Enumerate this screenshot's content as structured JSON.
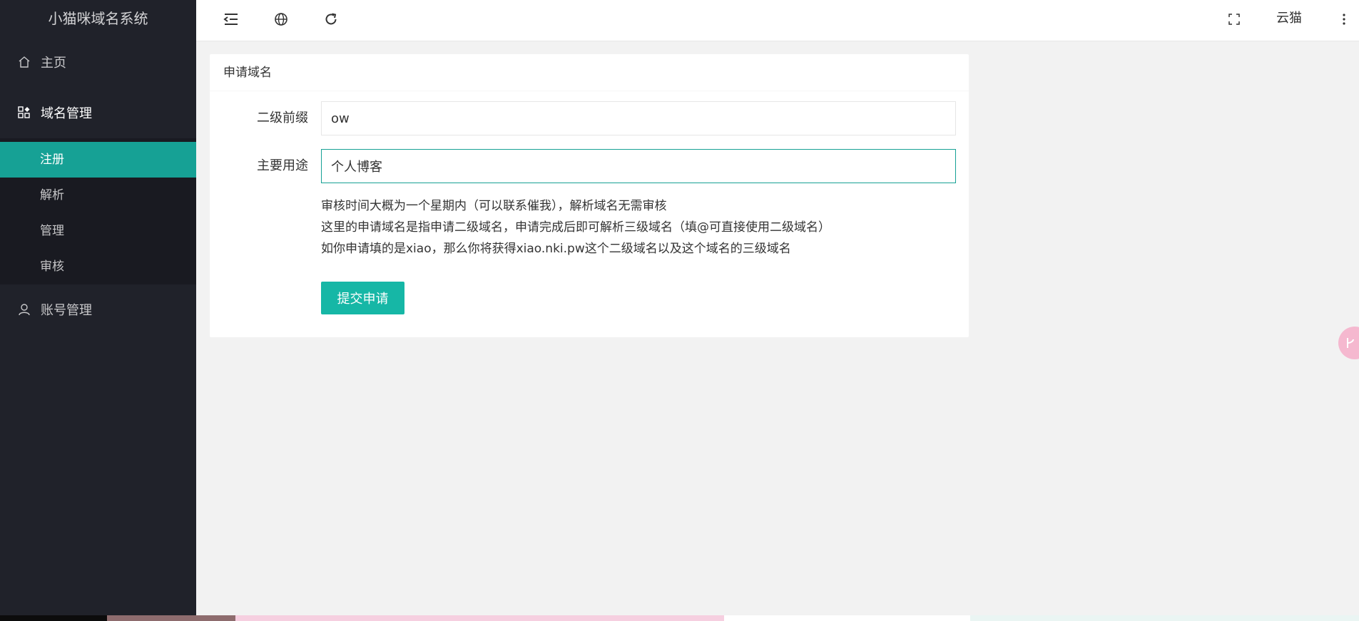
{
  "app": {
    "logo_text": "小猫咪域名系统"
  },
  "sidebar": {
    "items": [
      {
        "label": "主页",
        "icon": "home-icon"
      },
      {
        "label": "域名管理",
        "icon": "apps-icon",
        "expanded": true,
        "children": [
          {
            "label": "注册",
            "active": true
          },
          {
            "label": "解析"
          },
          {
            "label": "管理"
          },
          {
            "label": "审核"
          }
        ]
      },
      {
        "label": "账号管理",
        "icon": "user-icon"
      }
    ]
  },
  "header": {
    "icons": [
      "collapse-menu-icon",
      "globe-icon",
      "refresh-icon",
      "fullscreen-icon",
      "more-vertical-icon"
    ],
    "username": "云猫"
  },
  "card": {
    "title": "申请域名",
    "fields": [
      {
        "label": "二级前缀",
        "value": "ow"
      },
      {
        "label": "主要用途",
        "value": "个人博客"
      }
    ],
    "tips": [
      "审核时间大概为一个星期内（可以联系催我），解析域名无需审核",
      "这里的申请域名是指申请二级域名，申请完成后即可解析三级域名（填@可直接使用二级域名）",
      "如你申请填的是xiao，那么你将获得xiao.nki.pw这个二级域名以及这个域名的三级域名"
    ],
    "submit_label": "提交申请"
  },
  "colors": {
    "sidebar_bg": "#20222a",
    "subnav_bg": "#191a21",
    "accent": "#16a195",
    "button": "#16b7a6",
    "page_bg": "#f2f2f2"
  }
}
